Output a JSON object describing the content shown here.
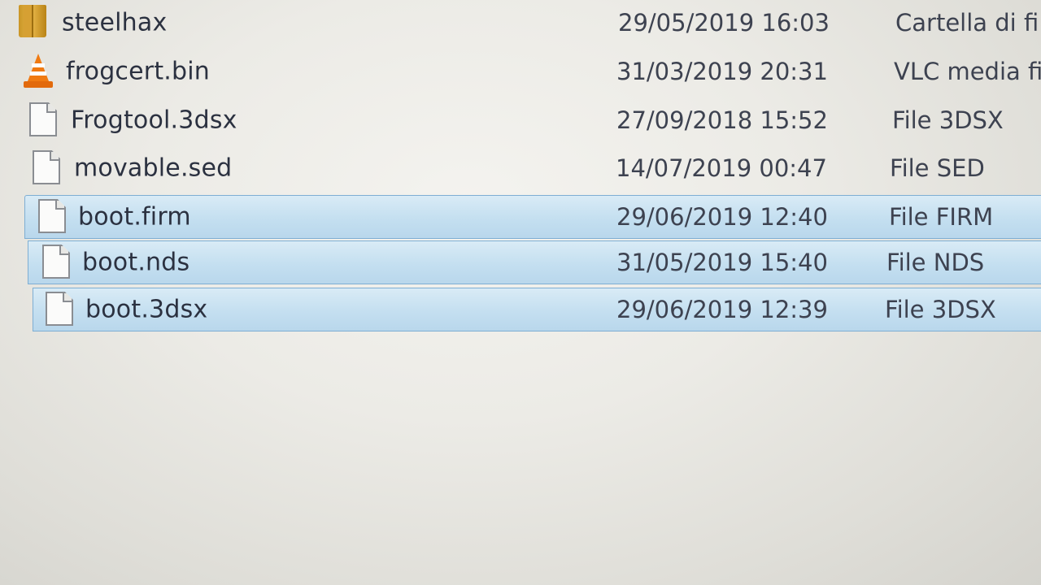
{
  "files": [
    {
      "name": "steelhax",
      "date": "29/05/2019 16:03",
      "type": "Cartella di fi",
      "icon": "folder-icon",
      "selected": false
    },
    {
      "name": "frogcert.bin",
      "date": "31/03/2019 20:31",
      "type": "VLC media fi",
      "icon": "vlc-icon",
      "selected": false
    },
    {
      "name": "Frogtool.3dsx",
      "date": "27/09/2018 15:52",
      "type": "File 3DSX",
      "icon": "file-icon",
      "selected": false
    },
    {
      "name": "movable.sed",
      "date": "14/07/2019 00:47",
      "type": "File SED",
      "icon": "file-icon",
      "selected": false
    },
    {
      "name": "boot.firm",
      "date": "29/06/2019 12:40",
      "type": "File FIRM",
      "icon": "file-icon",
      "selected": true
    },
    {
      "name": "boot.nds",
      "date": "31/05/2019 15:40",
      "type": "File NDS",
      "icon": "file-icon",
      "selected": true
    },
    {
      "name": "boot.3dsx",
      "date": "29/06/2019 12:39",
      "type": "File 3DSX",
      "icon": "file-icon",
      "selected": true
    }
  ],
  "colors": {
    "selection_fill": "#c4dff0",
    "selection_border": "#7eaed3",
    "text": "#2b3140"
  }
}
